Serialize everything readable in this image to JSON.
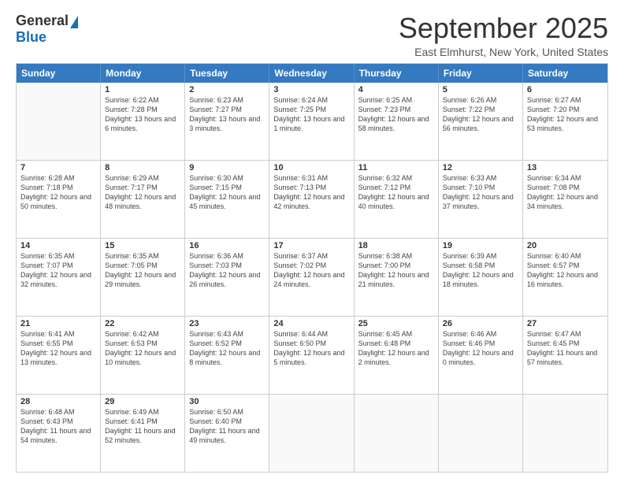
{
  "logo": {
    "general": "General",
    "blue": "Blue"
  },
  "title": "September 2025",
  "subtitle": "East Elmhurst, New York, United States",
  "headers": [
    "Sunday",
    "Monday",
    "Tuesday",
    "Wednesday",
    "Thursday",
    "Friday",
    "Saturday"
  ],
  "rows": [
    [
      {
        "day": "",
        "sunrise": "",
        "sunset": "",
        "daylight": ""
      },
      {
        "day": "1",
        "sunrise": "Sunrise: 6:22 AM",
        "sunset": "Sunset: 7:28 PM",
        "daylight": "Daylight: 13 hours and 6 minutes."
      },
      {
        "day": "2",
        "sunrise": "Sunrise: 6:23 AM",
        "sunset": "Sunset: 7:27 PM",
        "daylight": "Daylight: 13 hours and 3 minutes."
      },
      {
        "day": "3",
        "sunrise": "Sunrise: 6:24 AM",
        "sunset": "Sunset: 7:25 PM",
        "daylight": "Daylight: 13 hours and 1 minute."
      },
      {
        "day": "4",
        "sunrise": "Sunrise: 6:25 AM",
        "sunset": "Sunset: 7:23 PM",
        "daylight": "Daylight: 12 hours and 58 minutes."
      },
      {
        "day": "5",
        "sunrise": "Sunrise: 6:26 AM",
        "sunset": "Sunset: 7:22 PM",
        "daylight": "Daylight: 12 hours and 56 minutes."
      },
      {
        "day": "6",
        "sunrise": "Sunrise: 6:27 AM",
        "sunset": "Sunset: 7:20 PM",
        "daylight": "Daylight: 12 hours and 53 minutes."
      }
    ],
    [
      {
        "day": "7",
        "sunrise": "Sunrise: 6:28 AM",
        "sunset": "Sunset: 7:18 PM",
        "daylight": "Daylight: 12 hours and 50 minutes."
      },
      {
        "day": "8",
        "sunrise": "Sunrise: 6:29 AM",
        "sunset": "Sunset: 7:17 PM",
        "daylight": "Daylight: 12 hours and 48 minutes."
      },
      {
        "day": "9",
        "sunrise": "Sunrise: 6:30 AM",
        "sunset": "Sunset: 7:15 PM",
        "daylight": "Daylight: 12 hours and 45 minutes."
      },
      {
        "day": "10",
        "sunrise": "Sunrise: 6:31 AM",
        "sunset": "Sunset: 7:13 PM",
        "daylight": "Daylight: 12 hours and 42 minutes."
      },
      {
        "day": "11",
        "sunrise": "Sunrise: 6:32 AM",
        "sunset": "Sunset: 7:12 PM",
        "daylight": "Daylight: 12 hours and 40 minutes."
      },
      {
        "day": "12",
        "sunrise": "Sunrise: 6:33 AM",
        "sunset": "Sunset: 7:10 PM",
        "daylight": "Daylight: 12 hours and 37 minutes."
      },
      {
        "day": "13",
        "sunrise": "Sunrise: 6:34 AM",
        "sunset": "Sunset: 7:08 PM",
        "daylight": "Daylight: 12 hours and 34 minutes."
      }
    ],
    [
      {
        "day": "14",
        "sunrise": "Sunrise: 6:35 AM",
        "sunset": "Sunset: 7:07 PM",
        "daylight": "Daylight: 12 hours and 32 minutes."
      },
      {
        "day": "15",
        "sunrise": "Sunrise: 6:35 AM",
        "sunset": "Sunset: 7:05 PM",
        "daylight": "Daylight: 12 hours and 29 minutes."
      },
      {
        "day": "16",
        "sunrise": "Sunrise: 6:36 AM",
        "sunset": "Sunset: 7:03 PM",
        "daylight": "Daylight: 12 hours and 26 minutes."
      },
      {
        "day": "17",
        "sunrise": "Sunrise: 6:37 AM",
        "sunset": "Sunset: 7:02 PM",
        "daylight": "Daylight: 12 hours and 24 minutes."
      },
      {
        "day": "18",
        "sunrise": "Sunrise: 6:38 AM",
        "sunset": "Sunset: 7:00 PM",
        "daylight": "Daylight: 12 hours and 21 minutes."
      },
      {
        "day": "19",
        "sunrise": "Sunrise: 6:39 AM",
        "sunset": "Sunset: 6:58 PM",
        "daylight": "Daylight: 12 hours and 18 minutes."
      },
      {
        "day": "20",
        "sunrise": "Sunrise: 6:40 AM",
        "sunset": "Sunset: 6:57 PM",
        "daylight": "Daylight: 12 hours and 16 minutes."
      }
    ],
    [
      {
        "day": "21",
        "sunrise": "Sunrise: 6:41 AM",
        "sunset": "Sunset: 6:55 PM",
        "daylight": "Daylight: 12 hours and 13 minutes."
      },
      {
        "day": "22",
        "sunrise": "Sunrise: 6:42 AM",
        "sunset": "Sunset: 6:53 PM",
        "daylight": "Daylight: 12 hours and 10 minutes."
      },
      {
        "day": "23",
        "sunrise": "Sunrise: 6:43 AM",
        "sunset": "Sunset: 6:52 PM",
        "daylight": "Daylight: 12 hours and 8 minutes."
      },
      {
        "day": "24",
        "sunrise": "Sunrise: 6:44 AM",
        "sunset": "Sunset: 6:50 PM",
        "daylight": "Daylight: 12 hours and 5 minutes."
      },
      {
        "day": "25",
        "sunrise": "Sunrise: 6:45 AM",
        "sunset": "Sunset: 6:48 PM",
        "daylight": "Daylight: 12 hours and 2 minutes."
      },
      {
        "day": "26",
        "sunrise": "Sunrise: 6:46 AM",
        "sunset": "Sunset: 6:46 PM",
        "daylight": "Daylight: 12 hours and 0 minutes."
      },
      {
        "day": "27",
        "sunrise": "Sunrise: 6:47 AM",
        "sunset": "Sunset: 6:45 PM",
        "daylight": "Daylight: 11 hours and 57 minutes."
      }
    ],
    [
      {
        "day": "28",
        "sunrise": "Sunrise: 6:48 AM",
        "sunset": "Sunset: 6:43 PM",
        "daylight": "Daylight: 11 hours and 54 minutes."
      },
      {
        "day": "29",
        "sunrise": "Sunrise: 6:49 AM",
        "sunset": "Sunset: 6:41 PM",
        "daylight": "Daylight: 11 hours and 52 minutes."
      },
      {
        "day": "30",
        "sunrise": "Sunrise: 6:50 AM",
        "sunset": "Sunset: 6:40 PM",
        "daylight": "Daylight: 11 hours and 49 minutes."
      },
      {
        "day": "",
        "sunrise": "",
        "sunset": "",
        "daylight": ""
      },
      {
        "day": "",
        "sunrise": "",
        "sunset": "",
        "daylight": ""
      },
      {
        "day": "",
        "sunrise": "",
        "sunset": "",
        "daylight": ""
      },
      {
        "day": "",
        "sunrise": "",
        "sunset": "",
        "daylight": ""
      }
    ]
  ]
}
